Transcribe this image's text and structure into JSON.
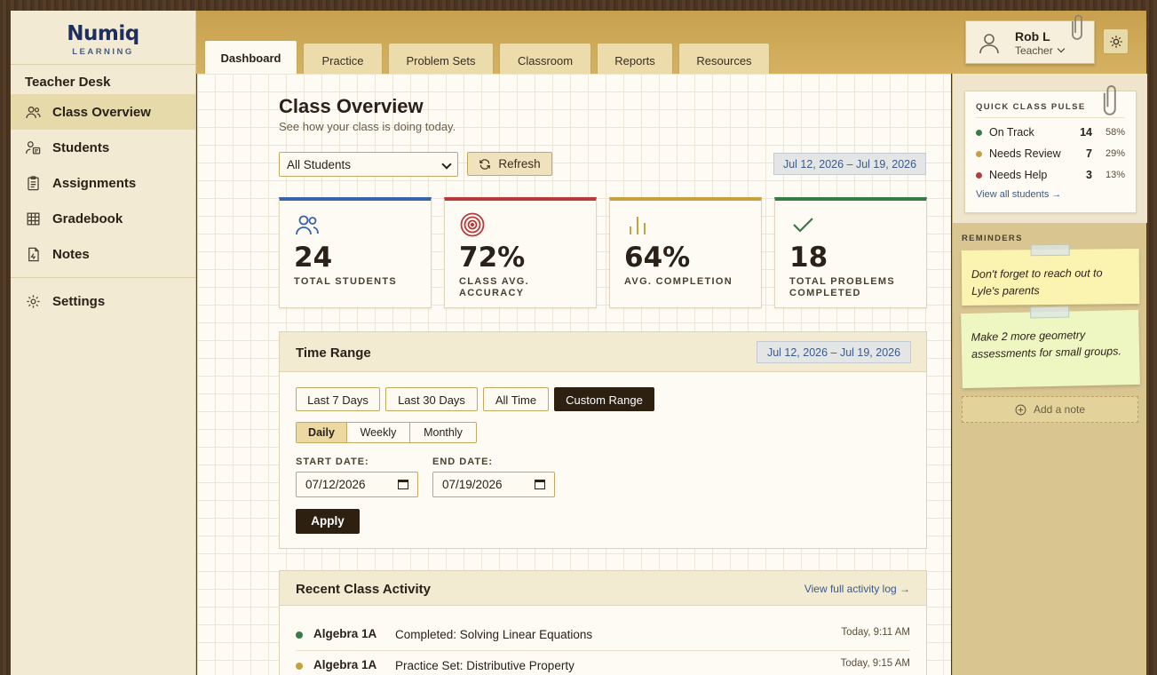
{
  "app": {
    "name": "Numiq",
    "tagline": "LEARNING"
  },
  "sidebar": {
    "section_title": "Teacher Desk",
    "items": [
      {
        "label": "Class Overview",
        "icon": "users-icon",
        "active": true
      },
      {
        "label": "Students",
        "icon": "student-icon"
      },
      {
        "label": "Assignments",
        "icon": "clipboard-icon"
      },
      {
        "label": "Gradebook",
        "icon": "grid-icon"
      },
      {
        "label": "Notes",
        "icon": "note-icon"
      }
    ],
    "settings_label": "Settings"
  },
  "tabs": [
    "Dashboard",
    "Practice",
    "Problem Sets",
    "Classroom",
    "Reports",
    "Resources"
  ],
  "user": {
    "name": "Rob L",
    "role": "Teacher"
  },
  "page": {
    "title": "Class Overview",
    "subtitle": "See how your class is doing today."
  },
  "filter": {
    "selected": "All Students",
    "refresh_label": "Refresh",
    "date_range": "Jul 12, 2026 – Jul 19, 2026"
  },
  "stats": [
    {
      "value": "24",
      "label": "TOTAL STUDENTS",
      "color": "#3a64a8"
    },
    {
      "value": "72%",
      "label": "CLASS AVG. ACCURACY",
      "color": "#b83a3a"
    },
    {
      "value": "64%",
      "label": "AVG. COMPLETION",
      "color": "#c8a040"
    },
    {
      "value": "18",
      "label": "TOTAL PROBLEMS COMPLETED",
      "color": "#3a7a48"
    }
  ],
  "time_range": {
    "title": "Time Range",
    "date_range": "Jul 12, 2026 – Jul 19, 2026",
    "presets": [
      "Last 7 Days",
      "Last 30 Days",
      "All Time",
      "Custom Range"
    ],
    "granularity": [
      "Daily",
      "Weekly",
      "Monthly"
    ],
    "start_label": "START DATE:",
    "start_value": "07/12/2026",
    "end_label": "END DATE:",
    "end_value": "07/19/2026",
    "apply_label": "Apply"
  },
  "activity": {
    "title": "Recent Class Activity",
    "link": "View full activity log →",
    "rows": [
      {
        "class": "Algebra 1A",
        "desc": "Completed: Solving Linear Equations",
        "time": "Today, 9:11 AM",
        "color": "#3a7a48"
      },
      {
        "class": "Algebra 1A",
        "desc": "Practice Set: Distributive Property",
        "time": "Today, 9:15 AM",
        "color": "#c8a040"
      }
    ]
  },
  "pulse": {
    "title": "QUICK CLASS PULSE",
    "rows": [
      {
        "label": "On Track",
        "count": "14",
        "pct": "58%",
        "color": "#3a7a48"
      },
      {
        "label": "Needs Review",
        "count": "7",
        "pct": "29%",
        "color": "#c8a040"
      },
      {
        "label": "Needs Help",
        "count": "3",
        "pct": "13%",
        "color": "#b83a3a"
      }
    ],
    "link": "View all students →"
  },
  "reminders": {
    "title": "REMINDERS",
    "notes": [
      "Don't forget to reach out to Lyle's parents",
      "Make 2 more geometry assessments for small groups."
    ],
    "add_label": "Add a note"
  }
}
